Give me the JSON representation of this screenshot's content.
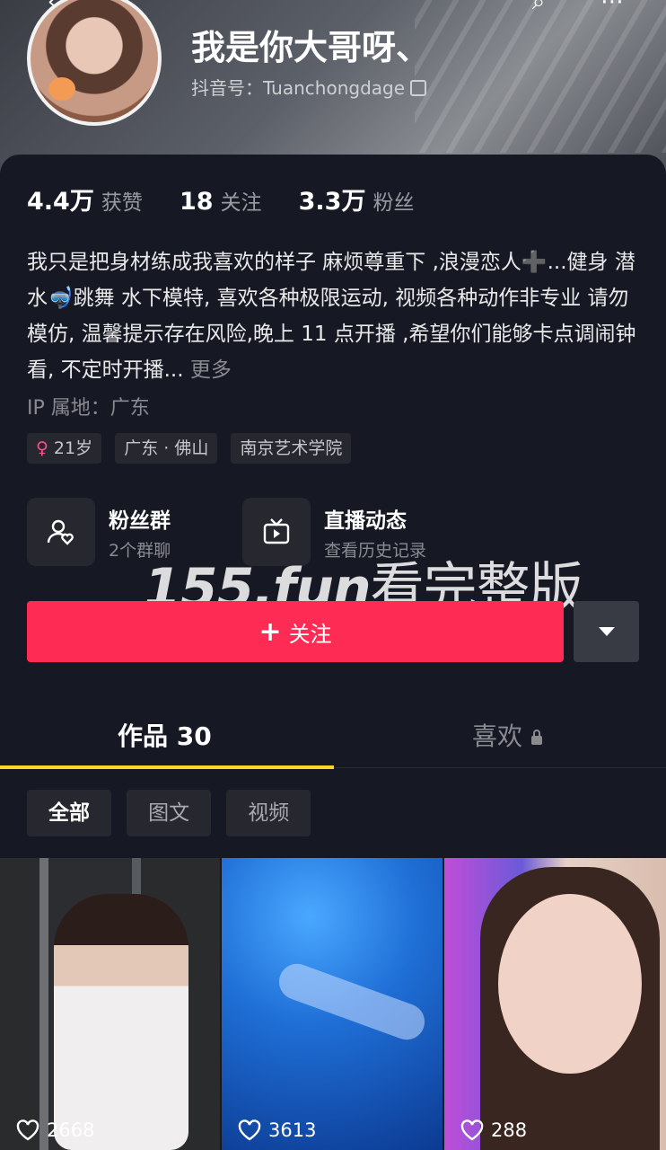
{
  "profile": {
    "name": "我是你大哥呀、",
    "douyin_id_label": "抖音号：",
    "douyin_id": "Tuanchongdage"
  },
  "stats": [
    {
      "num": "4.4万",
      "label": "获赞"
    },
    {
      "num": "18",
      "label": "关注"
    },
    {
      "num": "3.3万",
      "label": "粉丝"
    }
  ],
  "bio": {
    "text": "我只是把身材练成我喜欢的样子  麻烦尊重下 ,浪漫恋人➕...健身 潜水🤿跳舞  水下模特, 喜欢各种极限运动, 视频各种动作非专业 请勿模仿, 温馨提示存在风险,晚上 11 点开播 ,希望你们能够卡点调闹钟看,  不定时开播...",
    "more": "更多"
  },
  "ip": "IP 属地：广东",
  "tags": {
    "age": "21岁",
    "location": "广东 · 佛山",
    "school": "南京艺术学院"
  },
  "features": {
    "fan_group_title": "粉丝群",
    "fan_group_sub": "2个群聊",
    "live_title": "直播动态",
    "live_sub": "查看历史记录"
  },
  "watermark": {
    "en": "155.fun",
    "cn": "看完整版"
  },
  "follow_button": "关注",
  "tabs": {
    "works": "作品 30",
    "likes": "喜欢"
  },
  "filters": [
    "全部",
    "图文",
    "视频"
  ],
  "videos": [
    {
      "likes": "2668"
    },
    {
      "likes": "3613"
    },
    {
      "likes": "288"
    }
  ],
  "colors": {
    "background": "#161823",
    "follow": "#fe2c55",
    "tab_indicator": "#fcd52b"
  }
}
